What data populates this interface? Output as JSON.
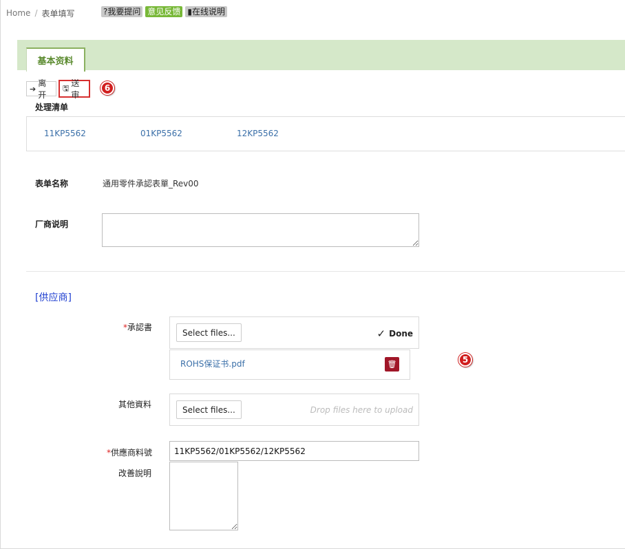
{
  "breadcrumb": {
    "home": "Home",
    "separator": "/",
    "current": "表单填写"
  },
  "header_badges": {
    "ask": "?我要提问",
    "feedback": "意见反馈",
    "help": "在线说明"
  },
  "tabs": [
    {
      "label": "基本资料"
    }
  ],
  "toolbar": {
    "leave": "离开",
    "submit": "送审"
  },
  "markers": {
    "submit_marker": "6",
    "upload_marker": "5"
  },
  "process_list": {
    "title": "处理清单",
    "items": [
      "11KP5562",
      "01KP5562",
      "12KP5562"
    ]
  },
  "form": {
    "name_label": "表单名称",
    "name_value": "通用零件承認表單_Rev00",
    "vendor_note_label": "厂商说明",
    "vendor_note_value": ""
  },
  "supplier": {
    "title": "[供应商]",
    "approval_label": "承認書",
    "approval_required": "*",
    "select_files": "Select files...",
    "done": "Done",
    "uploaded_file": "ROHS保证书.pdf",
    "other_label": "其他資料",
    "drop_hint": "Drop files here to upload",
    "part_no_required": "*",
    "part_no_label": "供應商料號",
    "part_no_value": "11KP5562/01KP5562/12KP5562",
    "improve_label": "改善說明",
    "improve_value": ""
  },
  "colors": {
    "tab_bar": "#d5e8c9",
    "tab_border": "#8ab05f",
    "link": "#3a6fa8",
    "group_title": "#1f3fd0",
    "marker": "#d11f1f",
    "trash": "#a01628"
  }
}
